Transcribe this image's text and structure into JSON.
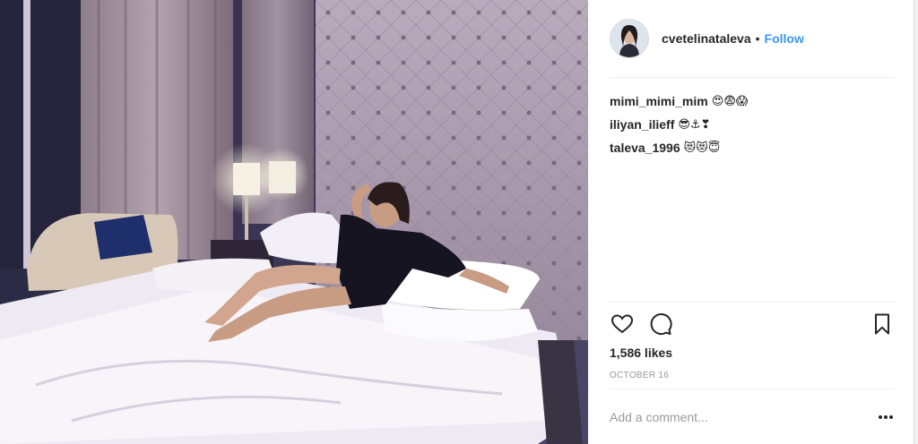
{
  "post": {
    "image_icon": "hotel-room-photo",
    "author": {
      "username": "cvetelinataleva",
      "separator": "•",
      "follow_label": "Follow",
      "avatar_icon": "avatar"
    },
    "comments": [
      {
        "user": "mimi_mimi_mim",
        "text": "😍😨😱"
      },
      {
        "user": "iliyan_ilieff",
        "text": "😎⚓❣"
      },
      {
        "user": "taleva_1996",
        "text": "😻😻😇"
      }
    ],
    "actions": {
      "like_icon": "heart-icon",
      "comment_icon": "comment-icon",
      "save_icon": "bookmark-icon"
    },
    "likes_text": "1,586 likes",
    "date_text": "OCTOBER 16",
    "comment_box": {
      "placeholder": "Add a comment...",
      "more_icon": "more-options-icon"
    },
    "colors": {
      "follow": "#3897f0",
      "text": "#262626",
      "muted": "#999999",
      "divider": "#efefef"
    }
  }
}
